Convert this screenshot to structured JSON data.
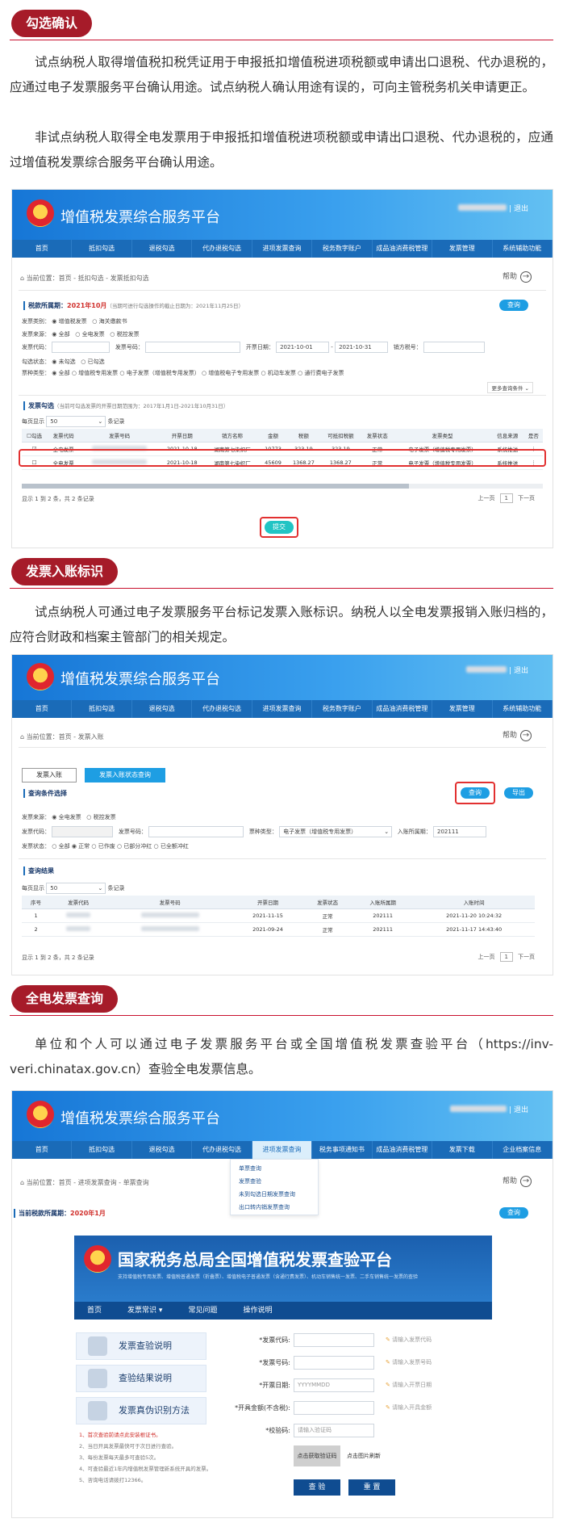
{
  "sections": [
    {
      "title": "勾选确认",
      "paragraphs": [
        "试点纳税人取得增值税扣税凭证用于申报抵扣增值税进项税额或申请出口退税、代办退税的，应通过电子发票服务平台确认用途。试点纳税人确认用途有误的，可向主管税务机关申请更正。",
        "非试点纳税人取得全电发票用于申报抵扣增值税进项税额或申请出口退税、代办退税的，应通过增值税发票综合服务平台确认用途。"
      ]
    },
    {
      "title": "发票入账标识",
      "paragraphs": [
        "试点纳税人可通过电子发票服务平台标记发票入账标识。纳税人以全电发票报销入账归档的，应符合财政和档案主管部门的相关规定。"
      ]
    },
    {
      "title": "全电发票查询",
      "paragraphs": [
        "单位和个人可以通过电子发票服务平台或全国增值税发票查验平台（https://inv-veri.chinatax.gov.cn）查验全电发票信息。"
      ]
    }
  ],
  "platform": {
    "title": "增值税发票综合服务平台",
    "logout": "退出",
    "help": "帮助",
    "nav1": [
      "首页",
      "抵扣勾选",
      "退税勾选",
      "代办退税勾选",
      "进项发票查询",
      "税务数字账户",
      "成品油消费税管理",
      "发票管理",
      "系统辅助功能"
    ],
    "nav3": [
      "首页",
      "抵扣勾选",
      "退税勾选",
      "代办退税勾选",
      "进项发票查询",
      "税务事项通知书",
      "成品油消费税管理",
      "发票下载",
      "企业档案信息"
    ]
  },
  "shot1": {
    "crumb": "当前位置：首页 - 抵扣勾选 - 发票抵扣勾选",
    "period_label": "税款所属期：",
    "period_value": "2021年10月",
    "period_note": "（当期可进行勾选操作的截止日期为：2021年11月25日）",
    "query_btn": "查询",
    "f_type": "发票类别：",
    "f_type_opts": [
      "增值税发票",
      "海关缴款书"
    ],
    "f_source": "发票来源：",
    "f_source_opts": [
      "全部",
      "全电发票",
      "税控发票"
    ],
    "f_code": "发票代码：",
    "f_no": "发票号码：",
    "f_date": "开票日期：",
    "date_from": "2021-10-01",
    "date_to": "2021-10-31",
    "f_seller": "销方税号：",
    "f_state": "勾选状态：",
    "f_state_opts": [
      "未勾选",
      "已勾选"
    ],
    "f_kind": "票种类型：",
    "f_kind_opts": [
      "全部",
      "增值税专用发票",
      "电子发票（增值税专用发票）",
      "增值税电子专用发票",
      "机动车发票",
      "通行费电子发票"
    ],
    "more": "更多查询条件",
    "list_title": "发票勾选",
    "list_note": "（当前可勾选发票的开票日期范围为：2017年1月1日-2021年10月31日）",
    "per_page_label": "每页显示",
    "per_page": "50",
    "per_page_unit": "条记录",
    "headers": [
      "勾选",
      "发票代码",
      "发票号码",
      "开票日期",
      "销方名称",
      "金额",
      "税额",
      "可抵扣税额",
      "发票状态",
      "发票类型",
      "信息来源",
      "是否"
    ],
    "rows": [
      [
        "全电发票",
        "2021-10-18",
        "湖南第七染织厂",
        "10773",
        "323.19",
        "323.19",
        "正常",
        "电子发票（增值税专用发票）",
        "系统推送"
      ],
      [
        "全电发票",
        "2021-10-18",
        "湖南第七染织厂",
        "45609",
        "1368.27",
        "1368.27",
        "正常",
        "电子发票（增值税专用发票）",
        "系统推送"
      ]
    ],
    "summary": "显示 1 到 2 条，共 2 条记录",
    "prev": "上一页",
    "page": "1",
    "next": "下一页",
    "submit": "提交"
  },
  "shot2": {
    "crumb": "当前位置：首页 - 发票入账",
    "tab1": "发票入账",
    "tab2": "发票入账状态查询",
    "cond_title": "查询条件选择",
    "query_btn": "查询",
    "export_btn": "导出",
    "f_source": "发票来源：",
    "f_source_opts": [
      "全电发票",
      "税控发票"
    ],
    "f_code": "发票代码：",
    "f_no": "发票号码：",
    "f_kind": "票种类型：",
    "kind_value": "电子发票（增值税专用发票）",
    "f_period": "入账所属期：",
    "period_value": "202111",
    "f_status": "发票状态：",
    "status_opts": [
      "全部",
      "正常",
      "已作废",
      "已部分冲红",
      "已全额冲红"
    ],
    "result_title": "查询结果",
    "per_page_label": "每页显示",
    "per_page": "50",
    "per_page_unit": "条记录",
    "headers": [
      "序号",
      "发票代码",
      "发票号码",
      "开票日期",
      "发票状态",
      "入账所属期",
      "入账时间"
    ],
    "rows": [
      [
        "1",
        "2021-11-15",
        "正常",
        "202111",
        "2021-11-20 10:24:32"
      ],
      [
        "2",
        "2021-09-24",
        "正常",
        "202111",
        "2021-11-17 14:43:40"
      ]
    ],
    "summary": "显示 1 到 2 条，共 2 条记录",
    "prev": "上一页",
    "page": "1",
    "next": "下一页"
  },
  "shot3": {
    "crumb": "当前位置：首页 - 进项发票查询 - 单票查询",
    "dropdown": [
      "单票查询",
      "发票查验",
      "未到勾选日期发票查询",
      "出口转内销发票查询"
    ],
    "period_label": "当前税款所属期：",
    "period_value": "2020年1月",
    "query_btn": "查询"
  },
  "verify": {
    "title": "国家税务总局全国增值税发票查验平台",
    "subtitle": "支持增值税专用发票、增值税普通发票（折叠票）、增值税电子普通发票（含通行费发票）、机动车销售统一发票、二手车销售统一发票的查验",
    "nav": [
      "首页",
      "发票常识",
      "常见问题",
      "操作说明"
    ],
    "side": [
      "发票查验说明",
      "查验结果说明",
      "发票真伪识别方法"
    ],
    "notes": [
      "1、首次查验前请点此安装根证书。",
      "2、当日开具发票最快可于次日进行查验。",
      "3、每份发票每天最多可查验5次。",
      "4、可查验最近1年内增值税发票管理新系统开具的发票。",
      "5、咨询电话请拨打12366。"
    ],
    "labels": [
      "*发票代码:",
      "*发票号码:",
      "*开票日期:",
      "*开具金额(不含税):",
      "*校验码:"
    ],
    "placeholders": [
      "",
      "",
      "YYYYMMDD",
      "",
      "请输入验证码"
    ],
    "hints": [
      "请输入发票代码",
      "请输入发票号码",
      "请输入开票日期",
      "请输入开具金额"
    ],
    "captcha_btn": "点击获取验证码",
    "captcha_hint": "点击图片刷新",
    "btn_check": "查 验",
    "btn_reset": "重 置"
  },
  "colors": {
    "accent": "#a61b29",
    "banner": "#1676d6",
    "nav": "#1a6bb8"
  }
}
